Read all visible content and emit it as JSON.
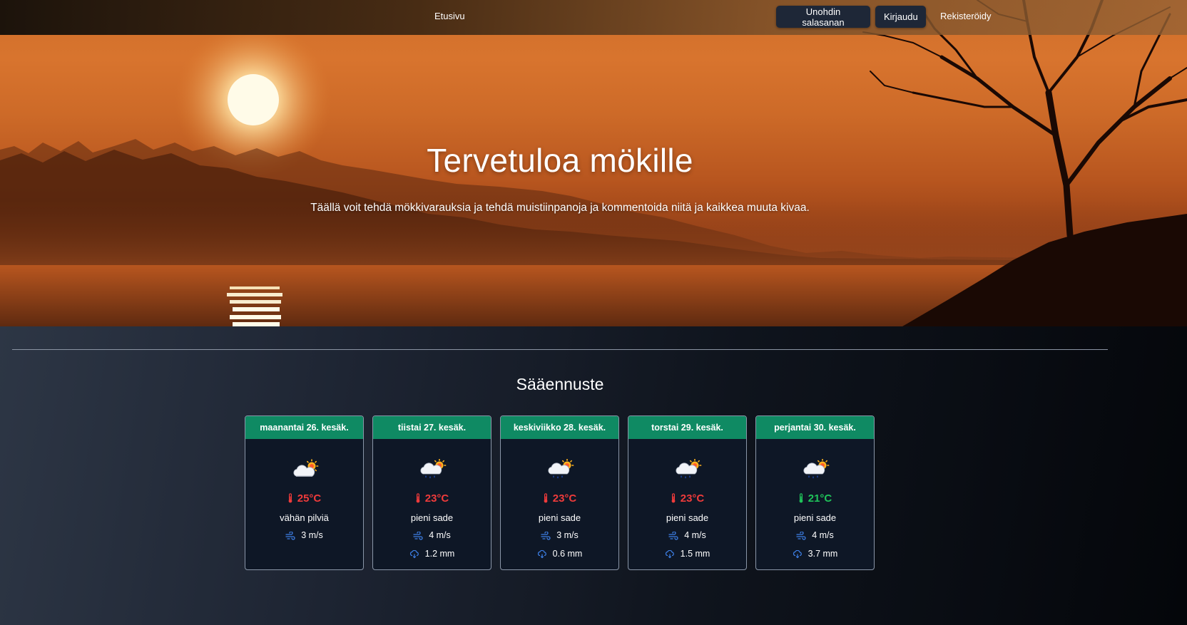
{
  "nav": {
    "home_label": "Etusivu",
    "forgot_password_label": "Unohdin salasanan",
    "login_label": "Kirjaudu",
    "register_label": "Rekisteröidy"
  },
  "hero": {
    "title": "Tervetuloa mökille",
    "subtitle": "Täällä voit tehdä mökkivarauksia ja tehdä muistiinpanoja ja kommentoida niitä ja kaikkea muuta kivaa."
  },
  "forecast": {
    "title": "Sääennuste",
    "colors": {
      "header_green": "#0f8a63",
      "temp_warm": "#ef3b3b",
      "temp_mild": "#1fc45a",
      "icon_blue": "#3d7fe6"
    },
    "days": [
      {
        "date": "maanantai 26. kesäk.",
        "icon": "partly-cloudy-icon",
        "temp": "25°C",
        "temp_color": "#ef3b3b",
        "description": "vähän pilviä",
        "wind": "3 m/s",
        "rain": ""
      },
      {
        "date": "tiistai 27. kesäk.",
        "icon": "light-rain-icon",
        "temp": "23°C",
        "temp_color": "#ef3b3b",
        "description": "pieni sade",
        "wind": "4 m/s",
        "rain": "1.2 mm"
      },
      {
        "date": "keskiviikko 28. kesäk.",
        "icon": "light-rain-icon",
        "temp": "23°C",
        "temp_color": "#ef3b3b",
        "description": "pieni sade",
        "wind": "3 m/s",
        "rain": "0.6 mm"
      },
      {
        "date": "torstai 29. kesäk.",
        "icon": "light-rain-icon",
        "temp": "23°C",
        "temp_color": "#ef3b3b",
        "description": "pieni sade",
        "wind": "4 m/s",
        "rain": "1.5 mm"
      },
      {
        "date": "perjantai 30. kesäk.",
        "icon": "light-rain-icon",
        "temp": "21°C",
        "temp_color": "#1fc45a",
        "description": "pieni sade",
        "wind": "4 m/s",
        "rain": "3.7 mm"
      }
    ]
  }
}
